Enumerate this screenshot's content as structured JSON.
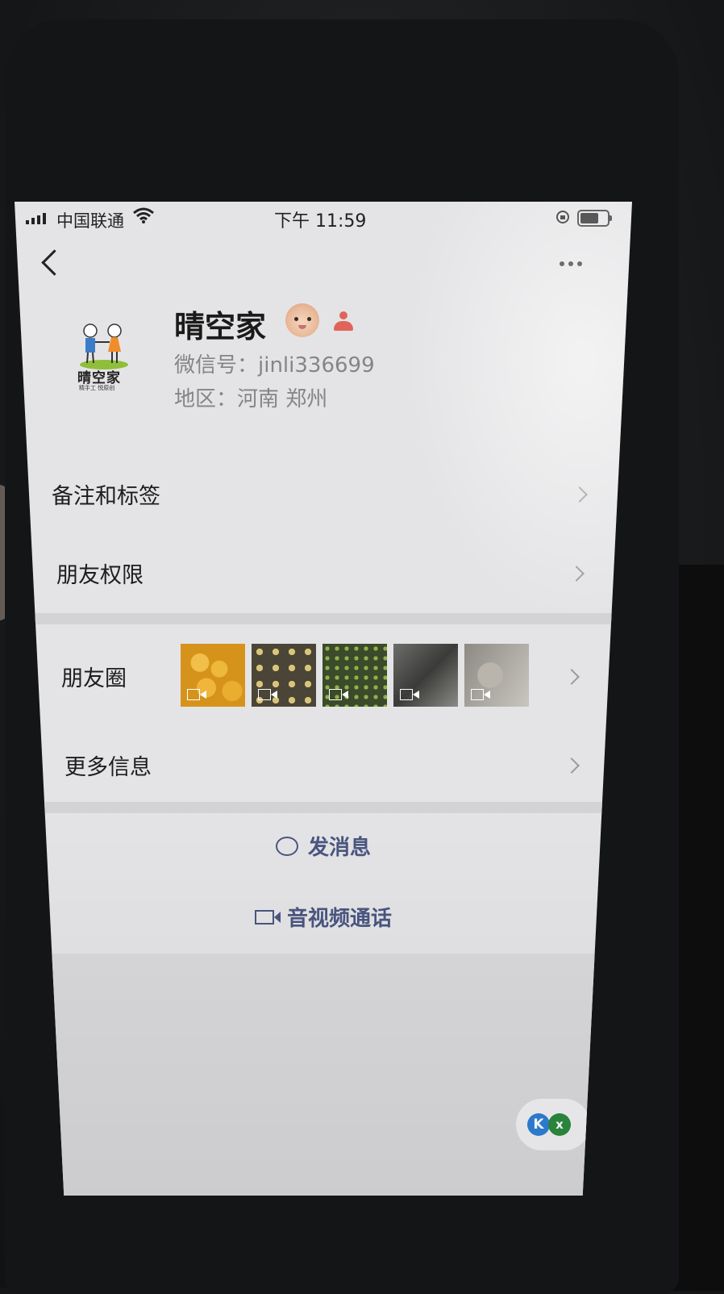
{
  "status_bar": {
    "carrier": "中国联通",
    "time": "下午 11:59"
  },
  "profile": {
    "nickname": "晴空家",
    "wechat_id": "微信号：jinli336699",
    "region": "地区：河南 郑州",
    "avatar_logo_text": "晴空家",
    "avatar_logo_subtext": "精手工 悦原创"
  },
  "menu": {
    "remark_tags": "备注和标签",
    "friend_permissions": "朋友权限",
    "moments": "朋友圈",
    "more_info": "更多信息"
  },
  "moments_thumbnails": [
    {
      "name": "yellow-balls",
      "video": true
    },
    {
      "name": "cookies-tray",
      "video": true
    },
    {
      "name": "green-peas",
      "video": true
    },
    {
      "name": "dark-liquid",
      "video": true
    },
    {
      "name": "grey-plates",
      "video": true
    }
  ],
  "actions": {
    "send_message": "发消息",
    "video_call": "音视频通话"
  },
  "floating_widget": {
    "k_label": "K",
    "x_label": "x"
  }
}
